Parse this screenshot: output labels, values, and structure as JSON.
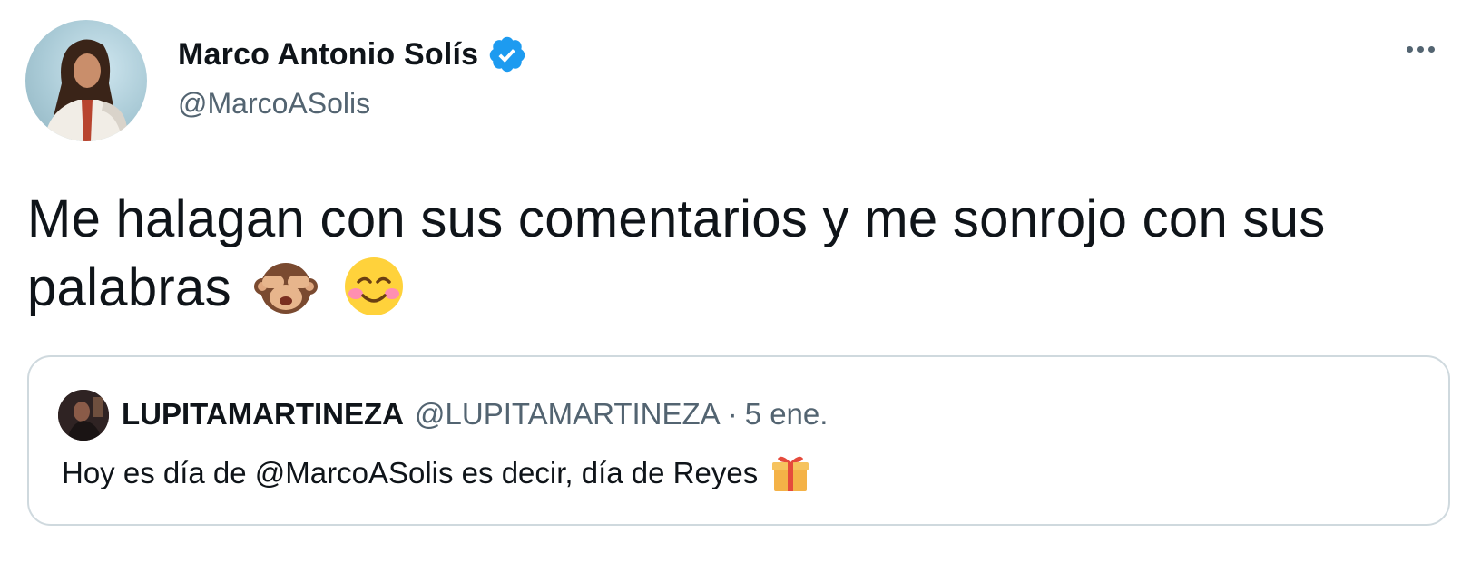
{
  "tweet": {
    "author_name": "Marco Antonio Solís",
    "author_handle": "@MarcoASolis",
    "verified": true,
    "text_line1": "Me halagan con sus comentarios y me sonrojo con sus",
    "text_line2": "palabras",
    "emojis": [
      "see-no-evil-monkey",
      "smiling-face-blushing"
    ]
  },
  "quoted_tweet": {
    "author_name": "LUPITAMARTINEZA",
    "author_handle": "@LUPITAMARTINEZA",
    "separator": "·",
    "date": "5 ene.",
    "text": "Hoy es día de @MarcoASolis es decir, día de Reyes",
    "emoji": "wrapped-gift"
  },
  "colors": {
    "verified_blue": "#1d9bf0",
    "secondary_text": "#536471",
    "border": "#cfd9de"
  }
}
